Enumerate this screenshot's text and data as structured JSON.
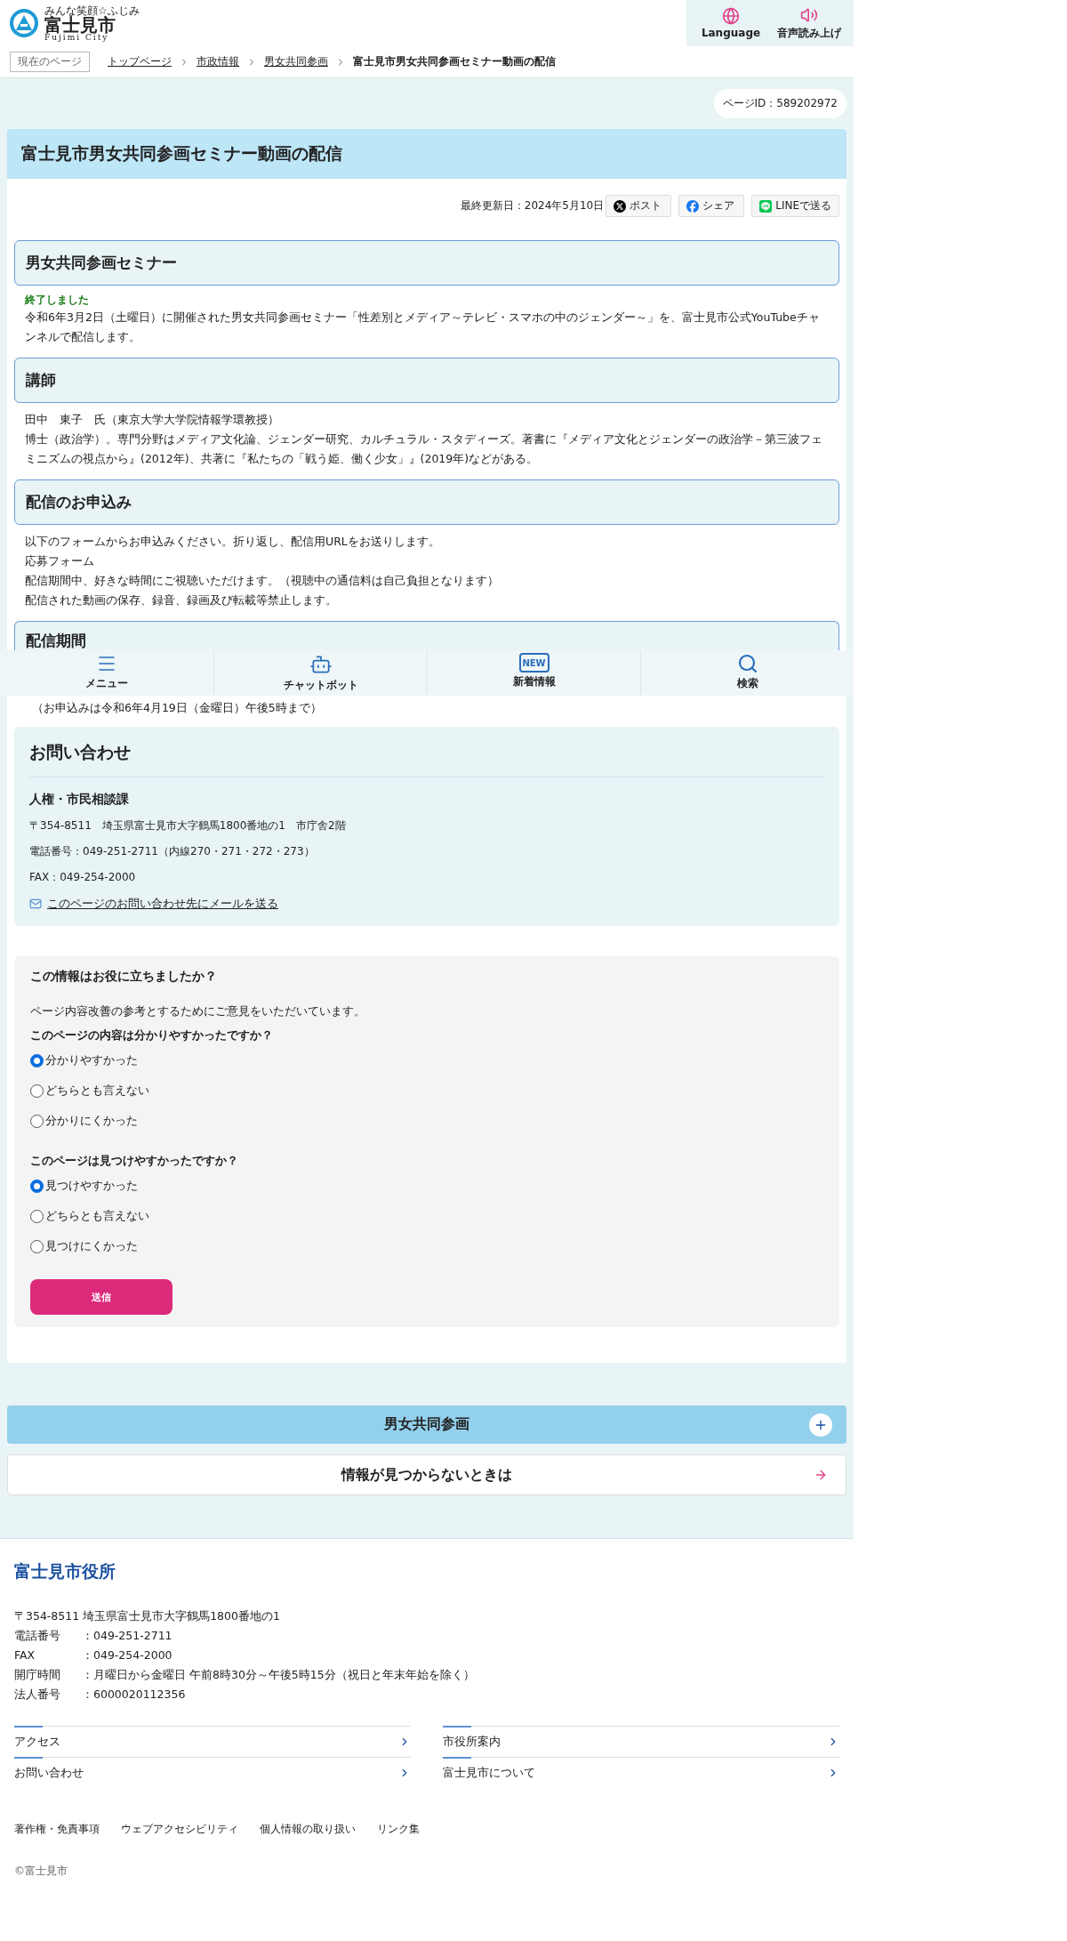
{
  "header": {
    "logo": {
      "tagline": "みんな笑顔☆ふじみ",
      "name": "富士見市",
      "roman": "Fujimi City"
    },
    "tools": [
      {
        "kind": "globe",
        "label": "Language"
      },
      {
        "kind": "speaker",
        "label": "音声読み上げ"
      }
    ]
  },
  "breadcrumb": {
    "label": "現在のページ",
    "links": [
      "トップページ",
      "市政情報",
      "男女共同参画"
    ],
    "current": "富士見市男女共同参画セミナー動画の配信"
  },
  "page_id": "ページID：589202972",
  "article": {
    "title": "富士見市男女共同参画セミナー動画の配信",
    "updated": "最終更新日：2024年5月10日",
    "share": [
      {
        "kind": "x",
        "label": "ポスト"
      },
      {
        "kind": "facebook",
        "label": "シェア"
      },
      {
        "kind": "line",
        "label": "LINEで送る"
      }
    ],
    "sections": [
      {
        "heading": "男女共同参画セミナー",
        "status": "終了しました",
        "paragraphs": [
          "令和6年3月2日（土曜日）に開催された男女共同参画セミナー「性差別とメディア～テレビ・スマホの中のジェンダー～」を、富士見市公式YouTubeチャンネルで配信します。"
        ]
      },
      {
        "heading": "講師",
        "paragraphs": [
          "田中　東子　氏（東京大学大学院情報学環教授）",
          "博士（政治学）。専門分野はメディア文化論、ジェンダー研究、カルチュラル・スタディーズ。著書に『メディア文化とジェンダーの政治学－第三波フェミニズムの視点から』(2012年)、共著に『私たちの「戦う姫、働く少女」』(2019年)などがある。"
        ]
      },
      {
        "heading": "配信のお申込み",
        "paragraphs": [
          "以下のフォームからお申込みください。折り返し、配信用URLをお送りします。",
          "応募フォーム",
          "配信期間中、好きな時間にご視聴いただけます。（視聴中の通信料は自己負担となります）",
          "配信された動画の保存、録音、録画及び転載等禁止します。"
        ]
      }
    ],
    "partial_heading": "配信期間",
    "note": "（お申込みは令和6年4月19日（金曜日）午後5時まで）",
    "contact": {
      "title": "お問い合わせ",
      "department": "人権・市民相談課",
      "lines": [
        "〒354-8511　埼玉県富士見市大字鶴馬1800番地の1　市庁舎2階",
        "電話番号：049-251-2711（内線270・271・272・273）",
        "FAX：049-254-2000"
      ],
      "mail_link": "このページのお問い合わせ先にメールを送る"
    },
    "feedback": {
      "title": "この情報はお役に立ちましたか？",
      "intro": "ページ内容改善の参考とするためにご意見をいただいています。",
      "questions": [
        {
          "label": "このページの内容は分かりやすかったですか？",
          "options": [
            {
              "label": "分かりやすかった",
              "selected": true
            },
            {
              "label": "どちらとも言えない",
              "selected": false
            },
            {
              "label": "分かりにくかった",
              "selected": false
            }
          ]
        },
        {
          "label": "このページは見つけやすかったですか？",
          "options": [
            {
              "label": "見つけやすかった",
              "selected": true
            },
            {
              "label": "どちらとも言えない",
              "selected": false
            },
            {
              "label": "見つけにくかった",
              "selected": false
            }
          ]
        }
      ],
      "submit": "送信"
    }
  },
  "bottom_nav": [
    {
      "kind": "menu",
      "label": "メニュー"
    },
    {
      "kind": "robot",
      "label": "チャットボット"
    },
    {
      "kind": "new",
      "label": "新着情報",
      "badge": "NEW"
    },
    {
      "kind": "search",
      "label": "検索"
    }
  ],
  "accordion": {
    "label": "男女共同参画",
    "expanded": false
  },
  "not_found_link": "情報が見つからないときは",
  "footer": {
    "title": "富士見市役所",
    "address": "〒354-8511 埼玉県富士見市大字鶴馬1800番地の1",
    "info": [
      {
        "label": "電話番号",
        "value": "：049-251-2711"
      },
      {
        "label": "FAX",
        "value": "：049-254-2000"
      },
      {
        "label": "開庁時間",
        "value": "：月曜日から金曜日 午前8時30分～午後5時15分（祝日と年末年始を除く）"
      },
      {
        "label": "法人番号",
        "value": "：6000020112356"
      }
    ],
    "links": [
      "アクセス",
      "市役所案内",
      "お問い合わせ",
      "富士見市について"
    ],
    "sub_links": [
      "著作権・免責事項",
      "ウェブアクセシビリティ",
      "個人情報の取り扱い",
      "リンク集"
    ],
    "copyright": "©富士見市"
  }
}
